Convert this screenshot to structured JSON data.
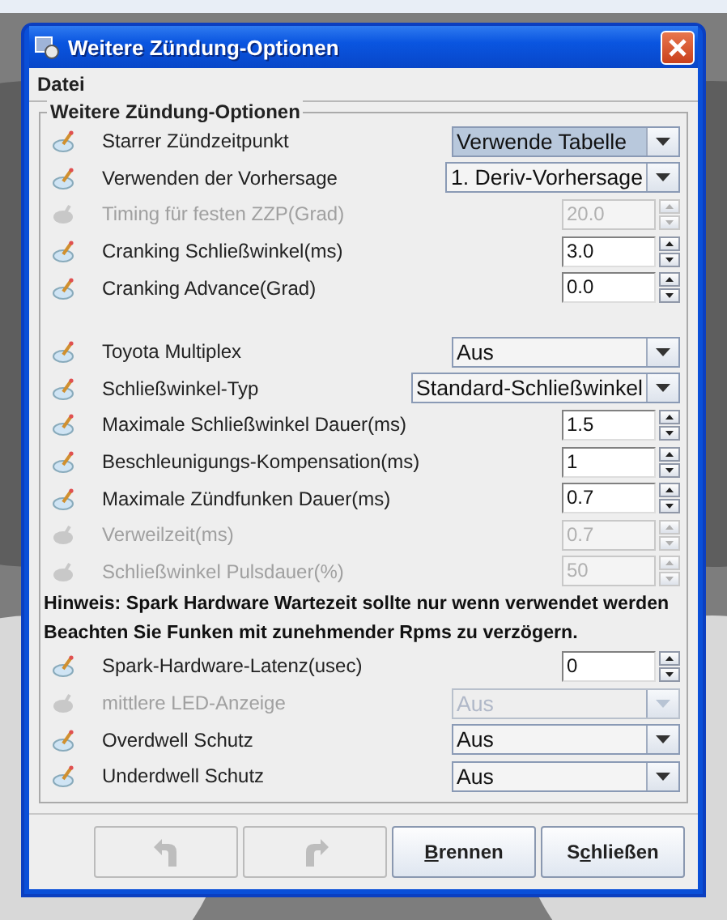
{
  "window": {
    "title": "Weitere Zündung-Optionen"
  },
  "menu": [
    {
      "label": "Datei"
    }
  ],
  "group": {
    "title": "Weitere Zündung-Optionen",
    "rows": [
      {
        "kind": "combo",
        "label": "Starrer Zündzeitpunkt",
        "value": "Verwende Tabelle",
        "disabled": false,
        "focused": true
      },
      {
        "kind": "combo",
        "label": "Verwenden der Vorhersage",
        "value": "1. Deriv-Vorhersage",
        "disabled": false,
        "focused": false
      },
      {
        "kind": "spinner",
        "label": "Timing für festen ZZP(Grad)",
        "value": "20.0",
        "disabled": true
      },
      {
        "kind": "spinner",
        "label": "Cranking Schließwinkel(ms)",
        "value": "3.0",
        "disabled": false
      },
      {
        "kind": "spinner",
        "label": "Cranking Advance(Grad)",
        "value": "0.0",
        "disabled": false
      },
      {
        "kind": "spacer"
      },
      {
        "kind": "combo",
        "label": "Toyota Multiplex",
        "value": "Aus",
        "disabled": false,
        "focused": false
      },
      {
        "kind": "combo",
        "label": "Schließwinkel-Typ",
        "value": "Standard-Schließwinkel",
        "disabled": false,
        "focused": false
      },
      {
        "kind": "spinner",
        "label": "Maximale Schließwinkel Dauer(ms)",
        "value": "1.5",
        "disabled": false
      },
      {
        "kind": "spinner",
        "label": "Beschleunigungs-Kompensation(ms)",
        "value": "1",
        "disabled": false
      },
      {
        "kind": "spinner",
        "label": "Maximale Zündfunken Dauer(ms)",
        "value": "0.7",
        "disabled": false
      },
      {
        "kind": "spinner",
        "label": "Verweilzeit(ms)",
        "value": "0.7",
        "disabled": true
      },
      {
        "kind": "spinner",
        "label": "Schließwinkel Pulsdauer(%)",
        "value": "50",
        "disabled": true
      },
      {
        "kind": "note",
        "text": "Hinweis: Spark Hardware Wartezeit sollte nur wenn verwendet werden"
      },
      {
        "kind": "note",
        "text": "Beachten Sie Funken mit zunehmender Rpms zu verzögern."
      },
      {
        "kind": "spinner",
        "label": "Spark-Hardware-Latenz(usec)",
        "value": "0",
        "disabled": false
      },
      {
        "kind": "combo",
        "label": "mittlere LED-Anzeige",
        "value": "Aus",
        "disabled": true,
        "focused": false
      },
      {
        "kind": "combo",
        "label": "Overdwell Schutz",
        "value": "Aus",
        "disabled": false,
        "focused": false
      },
      {
        "kind": "combo",
        "label": "Underdwell Schutz",
        "value": "Aus",
        "disabled": false,
        "focused": false
      }
    ]
  },
  "buttons": [
    {
      "kind": "undo",
      "disabled": true
    },
    {
      "kind": "redo",
      "disabled": true
    },
    {
      "kind": "text",
      "label_parts": [
        {
          "text": "B",
          "underline": true
        },
        {
          "text": "rennen",
          "underline": false
        }
      ],
      "disabled": false
    },
    {
      "kind": "text",
      "label_parts": [
        {
          "text": "S",
          "underline": false
        },
        {
          "text": "c",
          "underline": true
        },
        {
          "text": "hließen",
          "underline": false
        }
      ],
      "disabled": false
    }
  ]
}
